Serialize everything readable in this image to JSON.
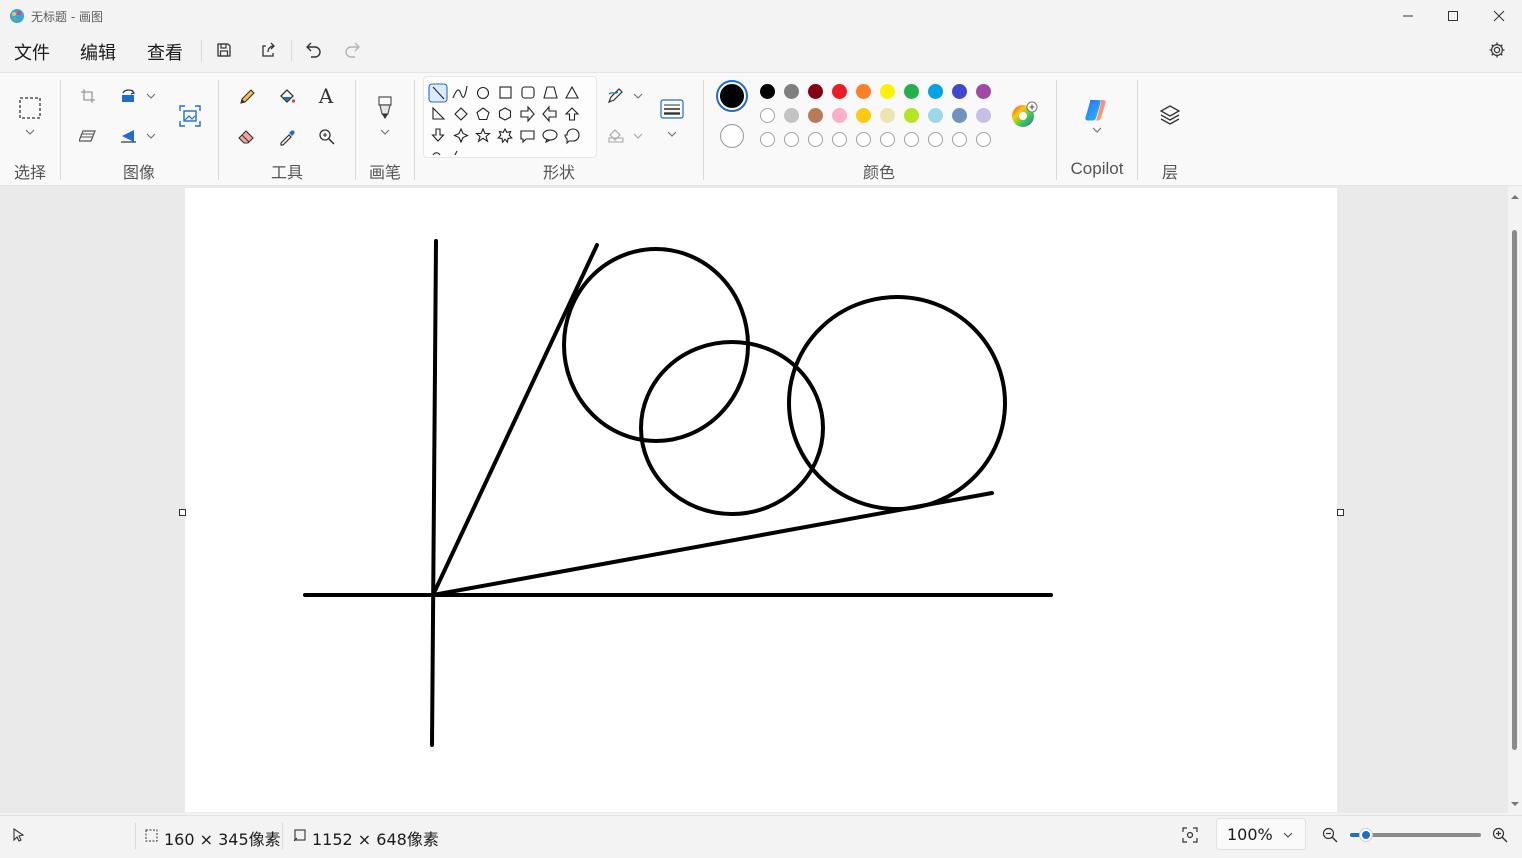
{
  "window": {
    "title": "无标题 - 画图"
  },
  "menu": {
    "file": "文件",
    "edit": "编辑",
    "view": "查看"
  },
  "ribbon": {
    "groups": {
      "select": "选择",
      "image": "图像",
      "tools": "工具",
      "brushes": "画笔",
      "shapes": "形状",
      "colors": "颜色",
      "copilot": "Copilot",
      "layers": "层"
    },
    "tools_text_icon": "A",
    "palette": {
      "row1": [
        "#000000",
        "#7f7f7f",
        "#880015",
        "#ed1c24",
        "#ff7f27",
        "#fff200",
        "#22b14c",
        "#00a2e8",
        "#3f48cc",
        "#a349a4"
      ],
      "row2": [
        "#ffffff",
        "#c3c3c3",
        "#b97a57",
        "#ffaec9",
        "#ffc90e",
        "#efe4b0",
        "#b5e61d",
        "#99d9ea",
        "#7092be",
        "#c8bfe7"
      ]
    },
    "primary_color": "#000000",
    "secondary_color": "#ffffff"
  },
  "status": {
    "selection_size": "160 × 345像素",
    "canvas_size": "1152 × 648像素",
    "zoom": "100%",
    "zoom_slider_fraction": 0.12
  }
}
